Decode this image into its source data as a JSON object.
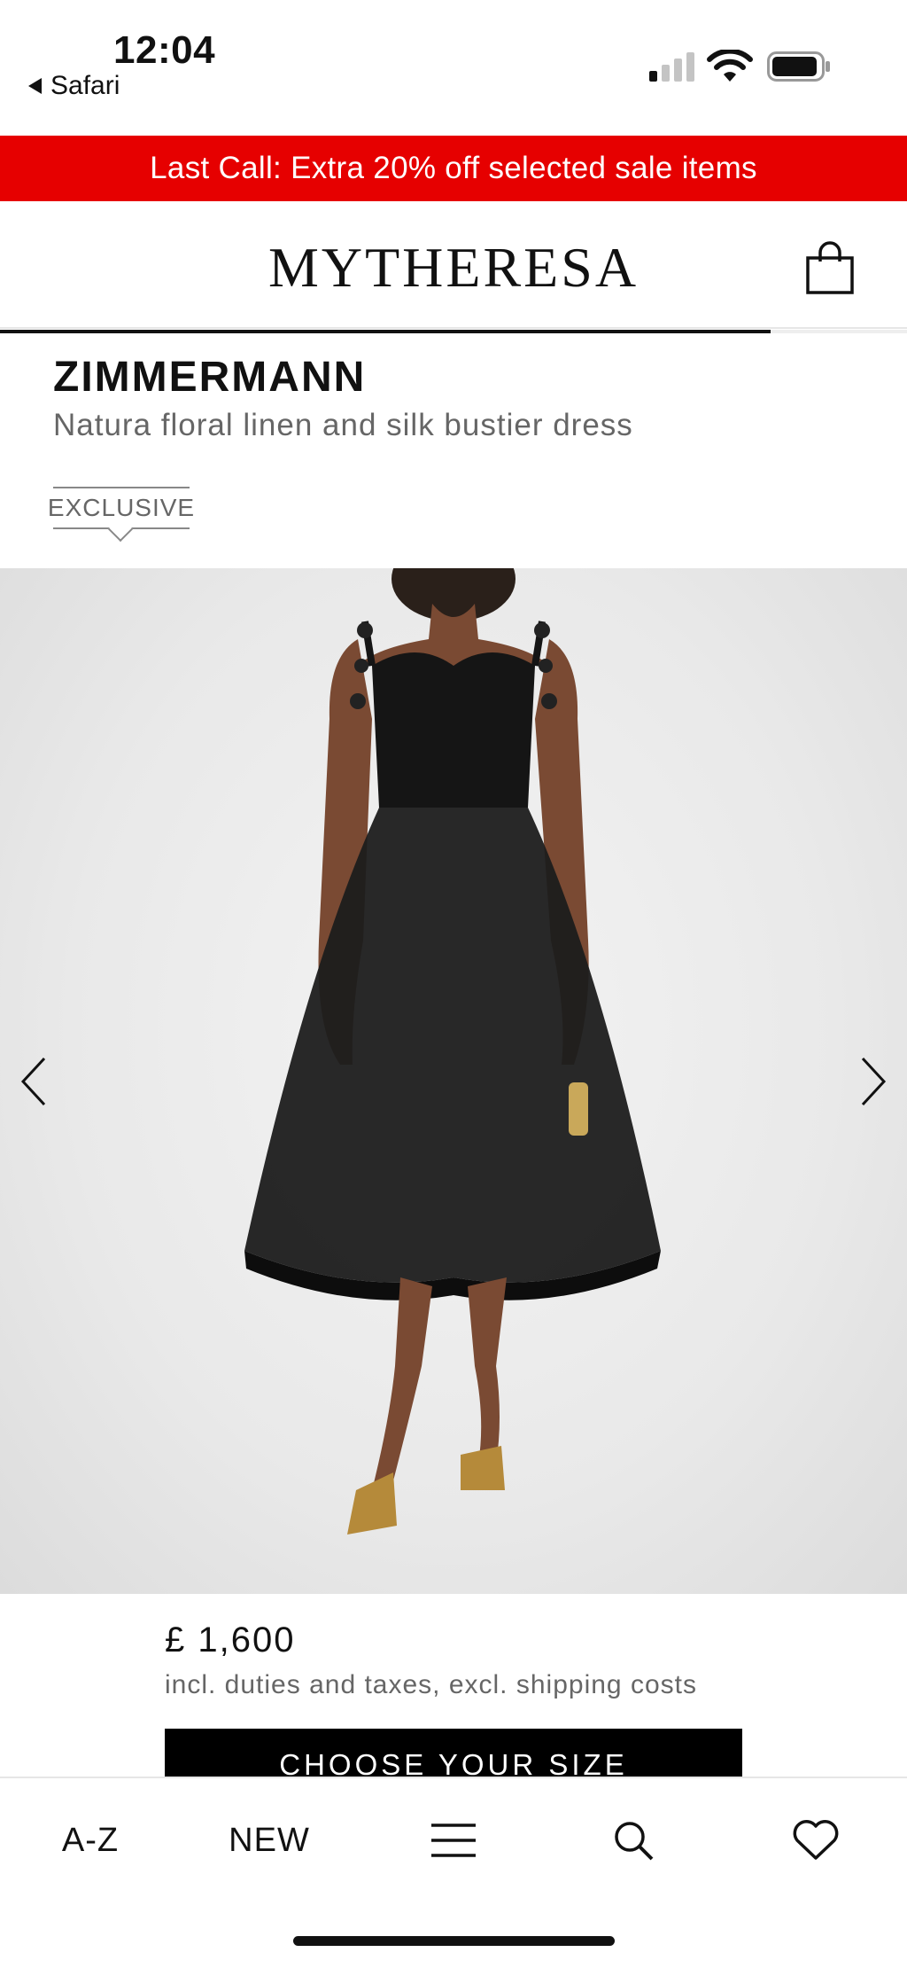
{
  "status_bar": {
    "time": "12:04",
    "back_app": "Safari",
    "signal_icon": "cellular-signal-icon",
    "wifi_icon": "wifi-icon",
    "battery_icon": "battery-icon"
  },
  "promo": {
    "text": "Last Call: Extra 20% off selected sale items",
    "background": "#e60000"
  },
  "header": {
    "logo": "MYTHERESA",
    "bag_icon": "shopping-bag-icon",
    "scroll_progress": 0.85
  },
  "product": {
    "brand": "ZIMMERMANN",
    "name": "Natura floral linen and silk bustier dress",
    "badge": "EXCLUSIVE",
    "price": "£ 1,600",
    "price_note": "incl. duties and taxes, excl. shipping costs",
    "cta": "CHOOSE YOUR SIZE"
  },
  "gallery": {
    "prev_icon": "chevron-left-icon",
    "next_icon": "chevron-right-icon"
  },
  "bottom_nav": {
    "items": [
      {
        "label": "A-Z"
      },
      {
        "label": "NEW"
      },
      {
        "icon": "menu-icon"
      },
      {
        "icon": "search-icon"
      },
      {
        "icon": "heart-icon"
      }
    ]
  }
}
